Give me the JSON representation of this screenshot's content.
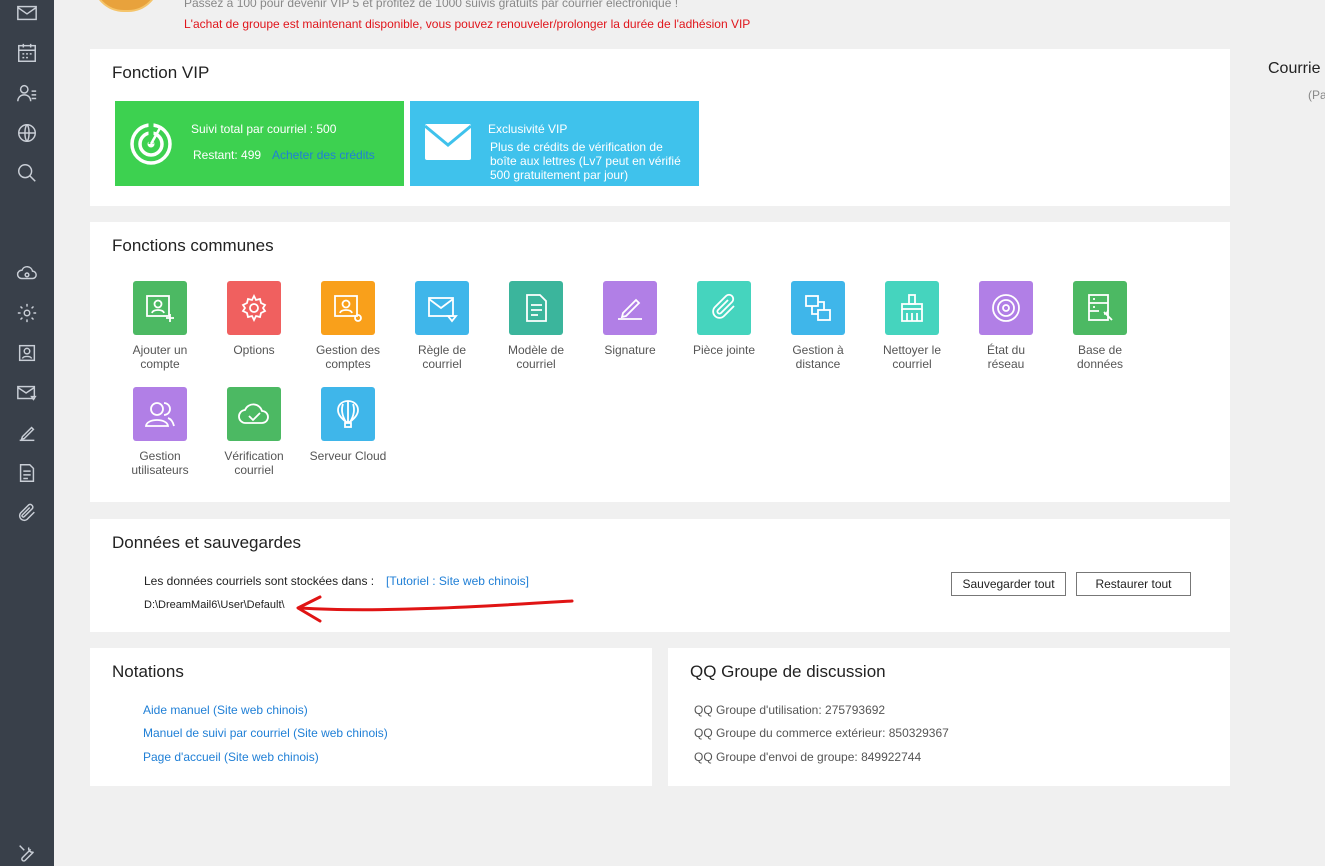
{
  "sidebar": {
    "icons": [
      "mail-icon",
      "calendar-icon",
      "contacts-icon",
      "globe-icon",
      "search-icon",
      "cloud-icon",
      "gear-icon",
      "account-icon",
      "mail-filter-icon",
      "signature-icon",
      "document-icon",
      "paperclip-icon",
      "tools-icon"
    ]
  },
  "header": {
    "promo_line": "Passez à 100 pour devenir VIP 5 et profitez de 1000 suivis gratuits par courrier électronique !",
    "notice": "L'achat de groupe est maintenant disponible, vous pouvez renouveler/prolonger la durée de l'adhésion VIP"
  },
  "vip": {
    "title": "Fonction VIP",
    "tracking": {
      "total_label": "Suivi total par courriel : 500",
      "remaining_label": "Restant: 499",
      "buy_link": "Acheter des crédits",
      "color": "#3dd150"
    },
    "exclusive": {
      "title": "Exclusivité VIP",
      "line1": "Plus de crédits de vérification de",
      "line2": "boîte aux lettres (Lv7 peut en vérifié",
      "line3": "500 gratuitement par jour)",
      "color": "#3fc2ec"
    }
  },
  "common": {
    "title": "Fonctions communes",
    "items": [
      {
        "l1": "Ajouter un",
        "l2": "compte",
        "color": "#4cb963",
        "icon": "add-account-icon"
      },
      {
        "l1": "Options",
        "l2": "",
        "color": "#f0605f",
        "icon": "gear-icon"
      },
      {
        "l1": "Gestion des",
        "l2": "comptes",
        "color": "#f9a01b",
        "icon": "account-settings-icon"
      },
      {
        "l1": "Règle de",
        "l2": "courriel",
        "color": "#3fb6ea",
        "icon": "mail-rule-icon"
      },
      {
        "l1": "Modèle de",
        "l2": "courriel",
        "color": "#3bb59c",
        "icon": "template-icon"
      },
      {
        "l1": "Signature",
        "l2": "",
        "color": "#b17fe6",
        "icon": "signature-icon"
      },
      {
        "l1": "Pièce jointe",
        "l2": "",
        "color": "#45d4be",
        "icon": "paperclip-icon"
      },
      {
        "l1": "Gestion à",
        "l2": "distance",
        "color": "#3fb6ea",
        "icon": "remote-icon"
      },
      {
        "l1": "Nettoyer le",
        "l2": "courriel",
        "color": "#45d4be",
        "icon": "broom-icon"
      },
      {
        "l1": "État du",
        "l2": "réseau",
        "color": "#b17fe6",
        "icon": "network-icon"
      },
      {
        "l1": "Base de",
        "l2": "données",
        "color": "#4cb963",
        "icon": "database-icon"
      },
      {
        "l1": "Gestion",
        "l2": "utilisateurs",
        "color": "#b17fe6",
        "icon": "users-icon"
      },
      {
        "l1": "Vérification",
        "l2": "courriel",
        "color": "#4cb963",
        "icon": "cloud-check-icon"
      },
      {
        "l1": "Serveur Cloud",
        "l2": "",
        "color": "#3fb6ea",
        "icon": "balloon-icon"
      }
    ]
  },
  "data_backup": {
    "title": "Données et sauvegardes",
    "stored_label": "Les données courriels sont stockées dans :",
    "tutorial_link": "[Tutoriel : Site web chinois]",
    "path": "D:\\DreamMail6\\User\\Default\\",
    "save_all": "Sauvegarder tout",
    "restore_all": "Restaurer tout"
  },
  "notations": {
    "title": "Notations",
    "links": [
      "Aide manuel (Site web chinois)",
      "Manuel de suivi par courriel (Site web chinois)",
      "Page d'accueil (Site web chinois)"
    ]
  },
  "qq": {
    "title": "QQ Groupe de discussion",
    "lines": [
      "QQ Groupe d'utilisation: 275793692",
      "QQ Groupe du commerce extérieur: 850329367",
      "QQ Groupe d'envoi de groupe: 849922744"
    ]
  },
  "right": {
    "title": "Courrie",
    "sub": "(Pa"
  }
}
